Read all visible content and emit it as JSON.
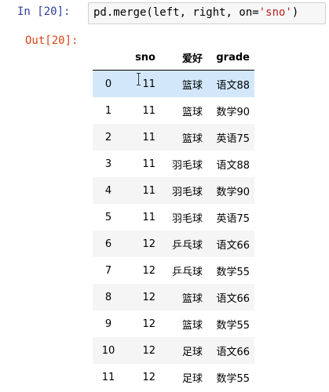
{
  "cell": {
    "in_prompt": "In  [20]:",
    "code_prefix": "pd.merge(left, right, on=",
    "code_string": "'sno'",
    "code_suffix": ")",
    "out_prompt": "Out[20]:"
  },
  "table": {
    "columns": [
      "sno",
      "爱好",
      "grade"
    ],
    "rows": [
      {
        "index": "0",
        "sno": "11",
        "hobby": "篮球",
        "grade": "语文88"
      },
      {
        "index": "1",
        "sno": "11",
        "hobby": "篮球",
        "grade": "数学90"
      },
      {
        "index": "2",
        "sno": "11",
        "hobby": "篮球",
        "grade": "英语75"
      },
      {
        "index": "3",
        "sno": "11",
        "hobby": "羽毛球",
        "grade": "语文88"
      },
      {
        "index": "4",
        "sno": "11",
        "hobby": "羽毛球",
        "grade": "数学90"
      },
      {
        "index": "5",
        "sno": "11",
        "hobby": "羽毛球",
        "grade": "英语75"
      },
      {
        "index": "6",
        "sno": "12",
        "hobby": "乒乓球",
        "grade": "语文66"
      },
      {
        "index": "7",
        "sno": "12",
        "hobby": "乒乓球",
        "grade": "数学55"
      },
      {
        "index": "8",
        "sno": "12",
        "hobby": "篮球",
        "grade": "语文66"
      },
      {
        "index": "9",
        "sno": "12",
        "hobby": "篮球",
        "grade": "数学55"
      },
      {
        "index": "10",
        "sno": "12",
        "hobby": "足球",
        "grade": "语文66"
      },
      {
        "index": "11",
        "sno": "12",
        "hobby": "足球",
        "grade": "数学55"
      }
    ]
  },
  "colors": {
    "in_prompt": "#303f9f",
    "out_prompt": "#d84315",
    "string": "#ba2121",
    "row_hover": "#d2e8fa",
    "row_stripe": "#f5f5f5"
  }
}
